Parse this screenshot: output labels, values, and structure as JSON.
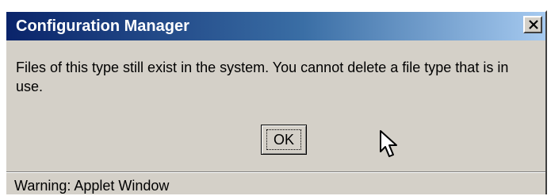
{
  "window": {
    "title": "Configuration Manager",
    "close_icon": "close-icon"
  },
  "dialog": {
    "message": "Files of this type still exist in the system.  You cannot delete a file type that is in use.",
    "ok_label": "OK"
  },
  "status": {
    "text": "Warning: Applet Window"
  },
  "colors": {
    "titlebar_start": "#0a246a",
    "titlebar_end": "#a6caf0",
    "face": "#d4d0c8"
  }
}
